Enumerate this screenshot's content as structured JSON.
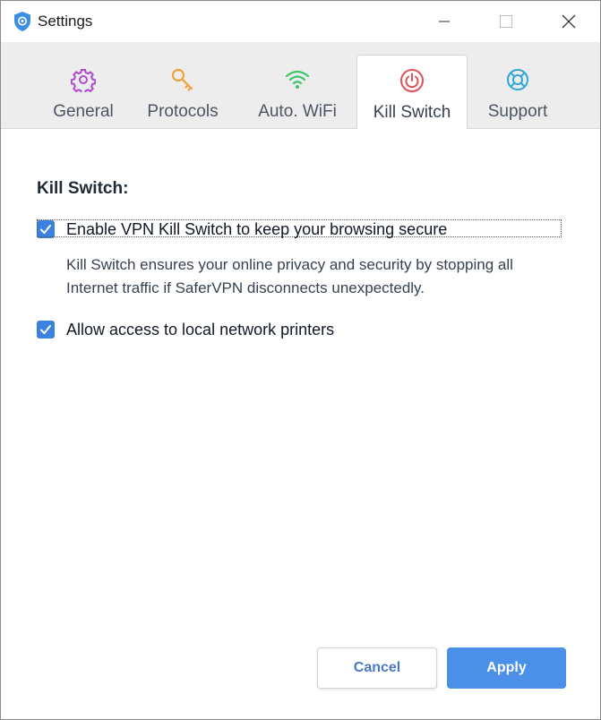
{
  "window": {
    "title": "Settings"
  },
  "tabs": [
    {
      "label": "General",
      "icon": "gear-icon",
      "color": "#b148d2"
    },
    {
      "label": "Protocols",
      "icon": "key-icon",
      "color": "#f2a33a"
    },
    {
      "label": "Auto. WiFi",
      "icon": "wifi-icon",
      "color": "#3ec46d"
    },
    {
      "label": "Kill Switch",
      "icon": "power-icon",
      "color": "#e0525a",
      "active": true
    },
    {
      "label": "Support",
      "icon": "lifebuoy-icon",
      "color": "#2ea6d9"
    }
  ],
  "killswitch": {
    "title": "Kill Switch:",
    "option1": {
      "label": "Enable VPN Kill Switch to keep your browsing secure",
      "checked": true,
      "description": "Kill Switch ensures your online privacy and security by stopping all Internet traffic if SaferVPN disconnects unexpectedly."
    },
    "option2": {
      "label": "Allow access to local network printers",
      "checked": true
    }
  },
  "buttons": {
    "cancel": "Cancel",
    "apply": "Apply"
  },
  "colors": {
    "accent": "#4a90e8",
    "checkbox": "#3b82e0"
  }
}
